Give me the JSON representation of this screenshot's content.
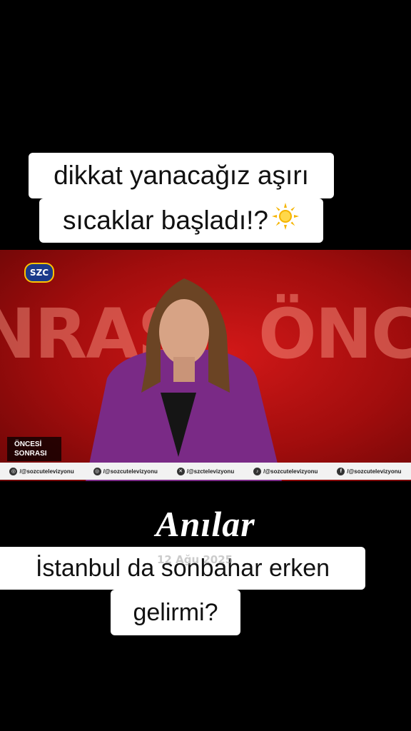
{
  "captions": {
    "top_line1": "dikkat yanacağız aşırı",
    "top_line2": "sıcaklar başladı!?",
    "top_emoji": "sun-emoji",
    "heading": "Anılar",
    "bottom_line1": "İstanbul da sonbahar erken",
    "bottom_line2": "gelirmi?"
  },
  "video": {
    "channel_logo": "SZC",
    "background_left": "NRAS",
    "background_right": "ÖNCI",
    "show_line1": "ÖNCESİ",
    "show_line2": "SONRASI",
    "accent_color": "#c8141b",
    "ticker": [
      {
        "icon": "instagram-icon",
        "text": "/@sozcutelevizyonu"
      },
      {
        "icon": "instagram-icon",
        "text": "/@sozcutelevizyonu"
      },
      {
        "icon": "x-icon",
        "text": "/@szctelevizyonu"
      },
      {
        "icon": "tiktok-icon",
        "text": "/@sozcutelevizyonu"
      },
      {
        "icon": "facebook-icon",
        "text": "/@sozcutelevizyonu"
      }
    ]
  },
  "watermark": "12 Ağu 2025"
}
